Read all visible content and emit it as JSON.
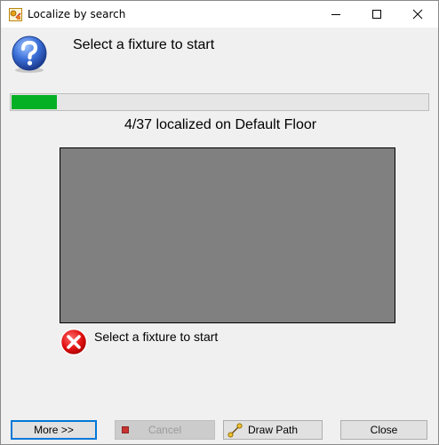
{
  "window": {
    "title": "Localize by search",
    "app_icon": "localize-app-icon",
    "controls": {
      "minimize": "minimize-icon",
      "maximize": "maximize-icon",
      "close": "close-icon"
    }
  },
  "header": {
    "icon": "question-icon",
    "message": "Select a fixture to start"
  },
  "progress": {
    "value": 4,
    "total": 37,
    "status_text": "4/37 localized on Default Floor",
    "color": "#06b025"
  },
  "preview": {
    "background": "#808080"
  },
  "error": {
    "icon": "error-icon",
    "message": "Select a fixture to start"
  },
  "buttons": {
    "more": "More >>",
    "cancel": "Cancel",
    "draw_path": "Draw Path",
    "close": "Close"
  }
}
